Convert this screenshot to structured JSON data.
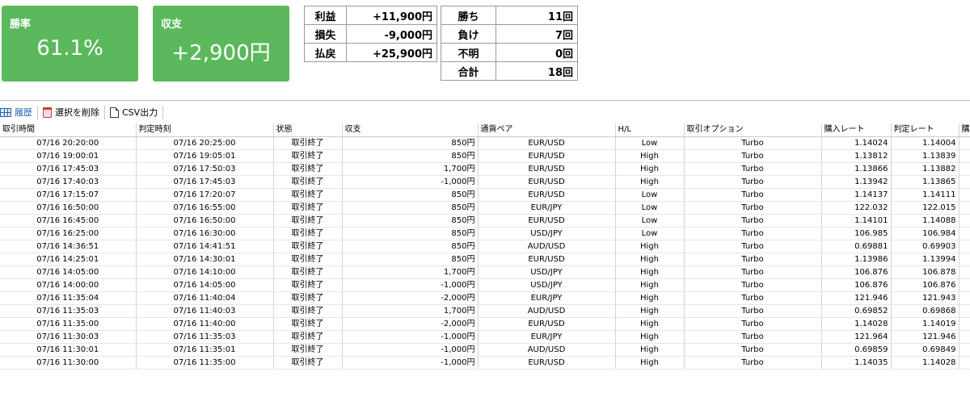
{
  "cards": {
    "winrate": {
      "label": "勝率",
      "value": "61.1%"
    },
    "balance": {
      "label": "収支",
      "value": "+2,900円"
    }
  },
  "summary_left": [
    {
      "key": "利益",
      "value": "+11,900円"
    },
    {
      "key": "損失",
      "value": "-9,000円"
    },
    {
      "key": "払戻",
      "value": "+25,900円"
    }
  ],
  "summary_right": [
    {
      "key": "勝ち",
      "value": "11回"
    },
    {
      "key": "負け",
      "value": "7回"
    },
    {
      "key": "不明",
      "value": "0回"
    },
    {
      "key": "合計",
      "value": "18回"
    }
  ],
  "toolbar": {
    "history": "履歴",
    "delete": "選択を削除",
    "csv": "CSV出力"
  },
  "columns": [
    "取引時間",
    "判定時刻",
    "状態",
    "収支",
    "通貨ペア",
    "H/L",
    "取引オプション",
    "購入レート",
    "判定レート",
    "購"
  ],
  "rows": [
    [
      "07/16 20:20:00",
      "07/16 20:25:00",
      "取引終了",
      "850円",
      "EUR/USD",
      "Low",
      "Turbo",
      "1.14024",
      "1.14004"
    ],
    [
      "07/16 19:00:01",
      "07/16 19:05:01",
      "取引終了",
      "850円",
      "EUR/USD",
      "High",
      "Turbo",
      "1.13812",
      "1.13839"
    ],
    [
      "07/16 17:45:03",
      "07/16 17:50:03",
      "取引終了",
      "1,700円",
      "EUR/USD",
      "High",
      "Turbo",
      "1.13866",
      "1.13882"
    ],
    [
      "07/16 17:40:03",
      "07/16 17:45:03",
      "取引終了",
      "-1,000円",
      "EUR/USD",
      "High",
      "Turbo",
      "1.13942",
      "1.13865"
    ],
    [
      "07/16 17:15:07",
      "07/16 17:20:07",
      "取引終了",
      "850円",
      "EUR/USD",
      "Low",
      "Turbo",
      "1.14137",
      "1.14111"
    ],
    [
      "07/16 16:50:00",
      "07/16 16:55:00",
      "取引終了",
      "850円",
      "EUR/JPY",
      "Low",
      "Turbo",
      "122.032",
      "122.015"
    ],
    [
      "07/16 16:45:00",
      "07/16 16:50:00",
      "取引終了",
      "850円",
      "EUR/USD",
      "Low",
      "Turbo",
      "1.14101",
      "1.14088"
    ],
    [
      "07/16 16:25:00",
      "07/16 16:30:00",
      "取引終了",
      "850円",
      "USD/JPY",
      "Low",
      "Turbo",
      "106.985",
      "106.984"
    ],
    [
      "07/16 14:36:51",
      "07/16 14:41:51",
      "取引終了",
      "850円",
      "AUD/USD",
      "High",
      "Turbo",
      "0.69881",
      "0.69903"
    ],
    [
      "07/16 14:25:01",
      "07/16 14:30:01",
      "取引終了",
      "850円",
      "EUR/USD",
      "High",
      "Turbo",
      "1.13986",
      "1.13994"
    ],
    [
      "07/16 14:05:00",
      "07/16 14:10:00",
      "取引終了",
      "1,700円",
      "USD/JPY",
      "High",
      "Turbo",
      "106.876",
      "106.878"
    ],
    [
      "07/16 14:00:00",
      "07/16 14:05:00",
      "取引終了",
      "-1,000円",
      "USD/JPY",
      "High",
      "Turbo",
      "106.876",
      "106.876"
    ],
    [
      "07/16 11:35:04",
      "07/16 11:40:04",
      "取引終了",
      "-2,000円",
      "EUR/JPY",
      "High",
      "Turbo",
      "121.946",
      "121.943"
    ],
    [
      "07/16 11:35:03",
      "07/16 11:40:03",
      "取引終了",
      "1,700円",
      "AUD/USD",
      "High",
      "Turbo",
      "0.69852",
      "0.69868"
    ],
    [
      "07/16 11:35:00",
      "07/16 11:40:00",
      "取引終了",
      "-2,000円",
      "EUR/USD",
      "High",
      "Turbo",
      "1.14028",
      "1.14019"
    ],
    [
      "07/16 11:30:03",
      "07/16 11:35:03",
      "取引終了",
      "-1,000円",
      "EUR/JPY",
      "High",
      "Turbo",
      "121.964",
      "121.946"
    ],
    [
      "07/16 11:30:01",
      "07/16 11:35:01",
      "取引終了",
      "-1,000円",
      "AUD/USD",
      "High",
      "Turbo",
      "0.69859",
      "0.69849"
    ],
    [
      "07/16 11:30:00",
      "07/16 11:35:00",
      "取引終了",
      "-1,000円",
      "EUR/USD",
      "High",
      "Turbo",
      "1.14035",
      "1.14028"
    ]
  ]
}
